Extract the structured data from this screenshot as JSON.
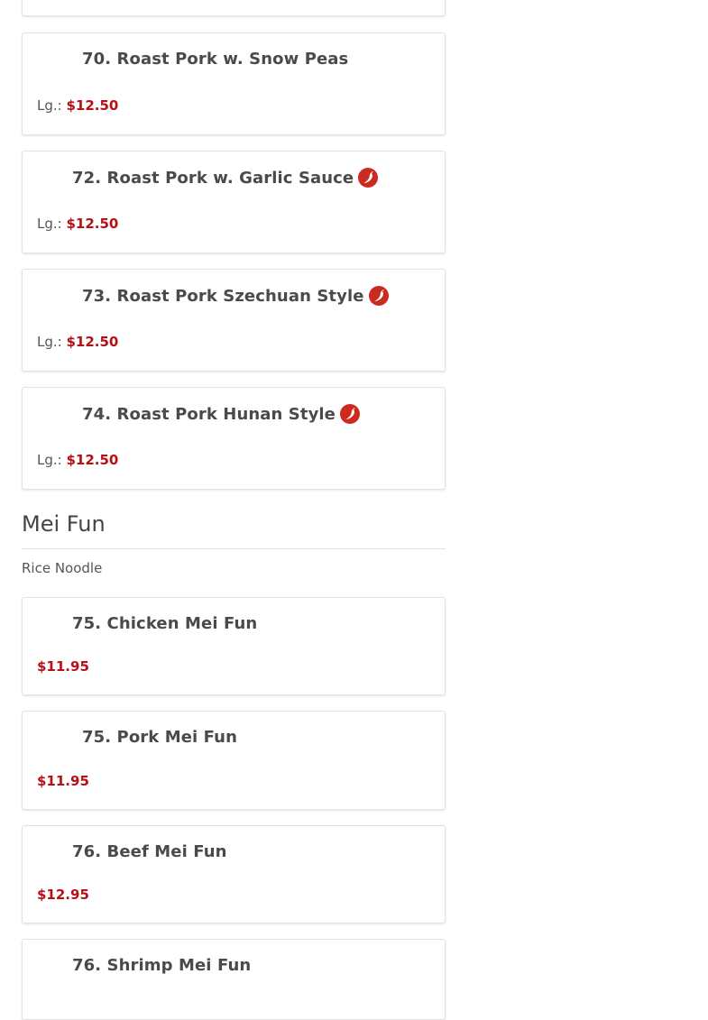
{
  "section": {
    "title": "Mei Fun",
    "subtitle": "Rice Noodle"
  },
  "items": [
    {
      "name": "70. Roast Pork w. Snow Peas",
      "size_label": "Lg.:",
      "price": "$12.50",
      "spicy": false
    },
    {
      "name": "72. Roast Pork w. Garlic Sauce",
      "size_label": "Lg.:",
      "price": "$12.50",
      "spicy": true
    },
    {
      "name": "73. Roast Pork Szechuan Style",
      "size_label": "Lg.:",
      "price": "$12.50",
      "spicy": true
    },
    {
      "name": "74. Roast Pork Hunan Style",
      "size_label": "Lg.:",
      "price": "$12.50",
      "spicy": true
    },
    {
      "name": "75. Chicken Mei Fun",
      "price": "$11.95",
      "spicy": false
    },
    {
      "name": "75. Pork Mei Fun",
      "price": "$11.95",
      "spicy": false
    },
    {
      "name": "76. Beef Mei Fun",
      "price": "$12.95",
      "spicy": false
    },
    {
      "name": "76. Shrimp Mei Fun",
      "spicy": false
    }
  ],
  "colors": {
    "price": "#b80f15",
    "spicy_icon": "#cc2a1f"
  },
  "icons": {
    "spicy": "hot-pepper-icon"
  }
}
